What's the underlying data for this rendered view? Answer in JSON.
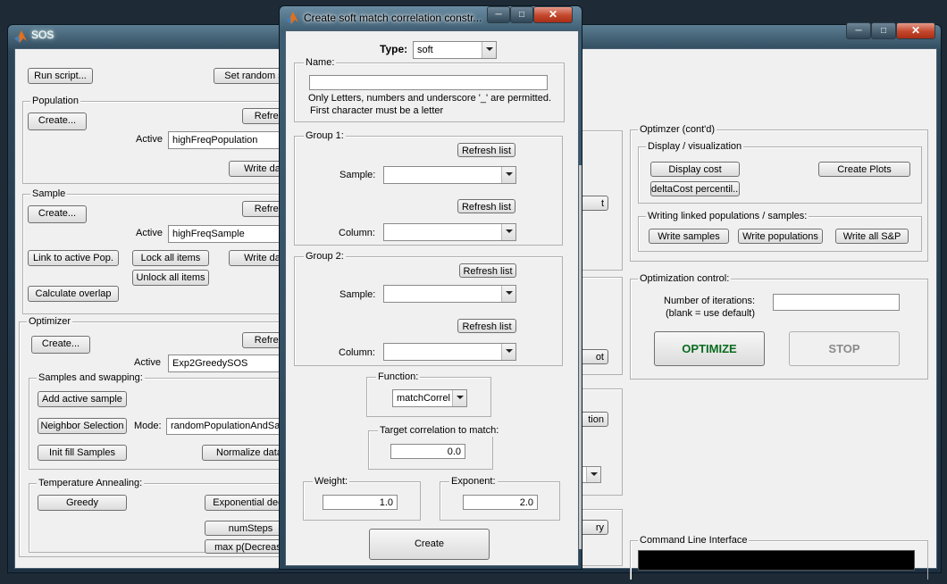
{
  "main_window": {
    "title": "SOS",
    "run_script": "Run script...",
    "set_random": "Set random s",
    "population": {
      "label": "Population",
      "create": "Create...",
      "refresh": "Refres",
      "active_label": "Active",
      "active_value": "highFreqPopulation",
      "write_data": "Write da"
    },
    "sample": {
      "label": "Sample",
      "create": "Create...",
      "refresh": "Refres",
      "active_label": "Active",
      "active_value": "highFreqSample",
      "link_active_pop": "Link to active Pop.",
      "lock_all": "Lock all items",
      "unlock_all": "Unlock all items",
      "write_data": "Write da",
      "calc_overlap": "Calculate overlap"
    },
    "optimizer": {
      "label": "Optimizer",
      "create": "Create...",
      "refresh": "Refres",
      "active_label": "Active",
      "active_value": "Exp2GreedySOS",
      "samples_swapping": {
        "label": "Samples and swapping:",
        "add_active_sample": "Add active sample",
        "neighbor_selection": "Neighbor Selection",
        "mode_label": "Mode:",
        "mode_value": "randomPopulationAndSa...",
        "init_fill": "Init fill Samples",
        "normalize": "Normalize data"
      },
      "temperature": {
        "label": "Temperature Annealing:",
        "greedy": "Greedy",
        "exp_decay": "Exponential deca",
        "numsteps": "numSteps",
        "max_p": "max p(Decrease"
      }
    },
    "middle_partial": {
      "btn1": "t",
      "btn2": "ot",
      "btn3": "tion",
      "btn4": "ry"
    },
    "optimizer_contd": {
      "label": "Optimzer (cont'd)",
      "display": {
        "label": "Display / visualization",
        "display_cost": "Display cost",
        "create_plots": "Create Plots",
        "delta_cost": "deltaCost percentil..."
      },
      "writing": {
        "label": "Writing linked populations / samples:",
        "write_samples": "Write samples",
        "write_populations": "Write populations",
        "write_all": "Write all S&P"
      }
    },
    "optimization_control": {
      "label": "Optimization control:",
      "iterations_label_1": "Number of iterations:",
      "iterations_label_2": "(blank = use default)",
      "iterations_value": "",
      "optimize": "OPTIMIZE",
      "stop": "STOP"
    },
    "cli": {
      "label": "Command Line Interface",
      "value": ""
    }
  },
  "dialog": {
    "title": "Create soft match correlation constr...",
    "type_label": "Type:",
    "type_value": "soft",
    "name": {
      "label": "Name:",
      "value": "",
      "hint_1": "Only Letters, numbers and underscore '_' are permitted.",
      "hint_2": "First character must be a letter"
    },
    "group1": {
      "label": "Group 1:",
      "refresh_1": "Refresh list",
      "sample_label": "Sample:",
      "sample_value": "",
      "refresh_2": "Refresh list",
      "column_label": "Column:",
      "column_value": ""
    },
    "group2": {
      "label": "Group 2:",
      "refresh_1": "Refresh list",
      "sample_label": "Sample:",
      "sample_value": "",
      "refresh_2": "Refresh list",
      "column_label": "Column:",
      "column_value": ""
    },
    "function": {
      "label": "Function:",
      "value": "matchCorrel"
    },
    "target": {
      "label": "Target correlation to match:",
      "value": "0.0"
    },
    "weight": {
      "label": "Weight:",
      "value": "1.0"
    },
    "exponent": {
      "label": "Exponent:",
      "value": "2.0"
    },
    "create": "Create"
  },
  "colors": {
    "optimize_text": "#0a6b1f",
    "stop_text": "#8a8a8a",
    "titlebar": "#3b5568"
  }
}
